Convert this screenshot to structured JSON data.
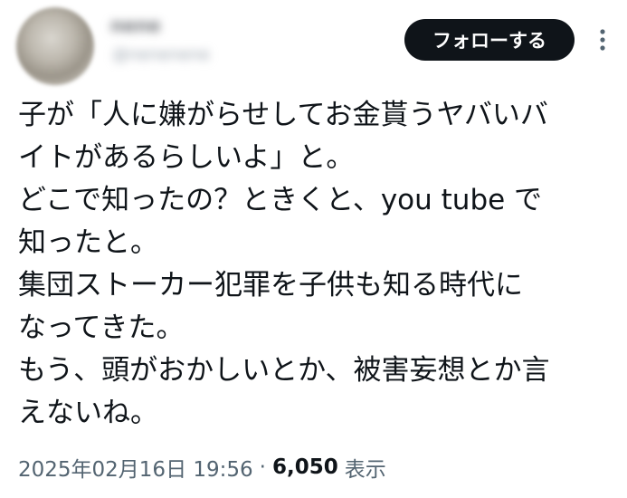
{
  "header": {
    "display_name": "nene",
    "handle": "@nenenene",
    "follow_label": "フォローする"
  },
  "tweet": {
    "lines": [
      "子が「人に嫌がらせしてお金貰うヤバいバ",
      "イトがあるらしいよ」と。",
      "どこで知ったの？ときくと、you tube で",
      "知ったと。",
      "集団ストーカー犯罪を子供も知る時代に",
      "なってきた。",
      "もう、頭がおかしいとか、被害妄想とか言",
      "えないね。"
    ]
  },
  "meta": {
    "timestamp": "2025年02月16日 19:56",
    "separator": "·",
    "views_count": "6,050",
    "views_label": "表示"
  },
  "icons": {
    "more": "more-vertical-icon"
  },
  "colors": {
    "text": "#0f1419",
    "secondary_text": "#536471",
    "follow_button_bg": "#0f1419",
    "follow_button_text": "#ffffff"
  }
}
